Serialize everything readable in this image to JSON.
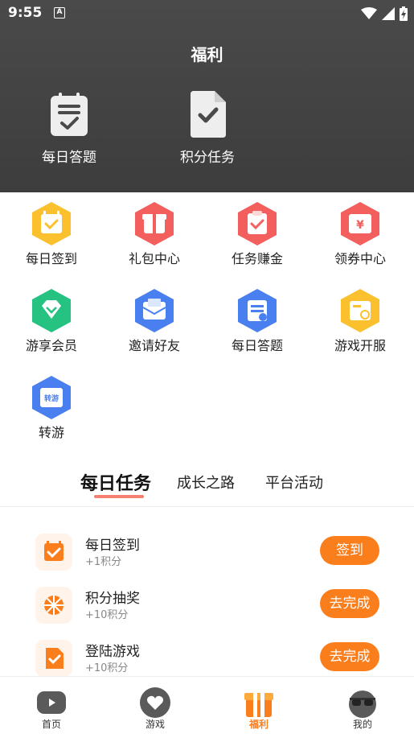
{
  "status_bar": {
    "time": "9:55",
    "notification_glyph": "A"
  },
  "header": {
    "title": "福利",
    "features": [
      {
        "label": "每日答题",
        "icon": "clipboard-check-icon"
      },
      {
        "label": "积分任务",
        "icon": "document-check-icon"
      }
    ]
  },
  "grid": {
    "items": [
      {
        "label": "每日签到",
        "icon": "calendar-check-icon",
        "color": "#fbc02d"
      },
      {
        "label": "礼包中心",
        "icon": "gift-box-icon",
        "color": "#f25f5c"
      },
      {
        "label": "任务赚金",
        "icon": "task-clipboard-icon",
        "color": "#f25f5c"
      },
      {
        "label": "领券中心",
        "icon": "coupon-yen-icon",
        "color": "#f25f5c"
      },
      {
        "label": "游享会员",
        "icon": "diamond-icon",
        "color": "#26c281"
      },
      {
        "label": "邀请好友",
        "icon": "mail-icon",
        "color": "#4a7ff0"
      },
      {
        "label": "每日答题",
        "icon": "quiz-clipboard-icon",
        "color": "#4a7ff0"
      },
      {
        "label": "游戏开服",
        "icon": "server-clock-icon",
        "color": "#fbc02d"
      },
      {
        "label": "转游",
        "icon": "transfer-game-icon",
        "color": "#4a7ff0",
        "badge": "转游"
      }
    ]
  },
  "tabs": [
    {
      "label": "每日任务",
      "active": true
    },
    {
      "label": "成长之路",
      "active": false
    },
    {
      "label": "平台活动",
      "active": false
    }
  ],
  "tasks": [
    {
      "title": "每日签到",
      "points": "+1积分",
      "button": "签到",
      "icon": "calendar-check-icon"
    },
    {
      "title": "积分抽奖",
      "points": "+10积分",
      "button": "去完成",
      "icon": "lottery-wheel-icon"
    },
    {
      "title": "登陆游戏",
      "points": "+10积分",
      "button": "去完成",
      "icon": "document-check-icon"
    }
  ],
  "bottom_nav": [
    {
      "label": "首页",
      "icon": "gamepad-icon",
      "active": false
    },
    {
      "label": "游戏",
      "icon": "heart-bubble-icon",
      "active": false
    },
    {
      "label": "福利",
      "icon": "gift-icon",
      "active": true
    },
    {
      "label": "我的",
      "icon": "sunglasses-avatar-icon",
      "active": false
    }
  ],
  "colors": {
    "accent": "#fb7e1d",
    "tab_underline": "#f58070",
    "header_bg": "#454545"
  }
}
